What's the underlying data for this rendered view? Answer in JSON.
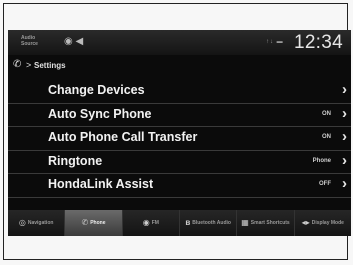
{
  "status_bar": {
    "audio_source": "Audio Source",
    "volume_icons": "◉ ◀",
    "signal_icons": "↑↓ ▬",
    "time": "12:34"
  },
  "breadcrumb": {
    "phone_icon": "phone-icon",
    "separator": ">",
    "title": "Settings"
  },
  "menu": [
    {
      "label": "Change Devices",
      "value": ""
    },
    {
      "label": "Auto Sync Phone",
      "value": "ON"
    },
    {
      "label": "Auto Phone Call Transfer",
      "value": "ON"
    },
    {
      "label": "Ringtone",
      "value": "Phone"
    },
    {
      "label": "HondaLink Assist",
      "value": "OFF"
    }
  ],
  "nav": {
    "tabs": [
      {
        "label": "Navigation",
        "icon": "navigation-icon",
        "glyph": "◎",
        "active": false
      },
      {
        "label": "Phone",
        "icon": "phone-icon",
        "glyph": "✆",
        "active": true
      },
      {
        "label": "FM",
        "icon": "radio-icon",
        "glyph": "◉",
        "active": false
      },
      {
        "label": "Bluetooth Audio",
        "icon": "bluetooth-icon",
        "glyph": "ʙ",
        "active": false
      },
      {
        "label": "Smart Shortcuts",
        "icon": "grid-icon",
        "glyph": "▦",
        "active": false
      },
      {
        "label": "Display Mode",
        "icon": "display-mode-icon",
        "glyph": "◂▸",
        "active": false
      }
    ]
  },
  "colors": {
    "screen_bg": "#0b0b0b",
    "text": "#f2f2f2",
    "active_tab": "#5a5a5a"
  }
}
